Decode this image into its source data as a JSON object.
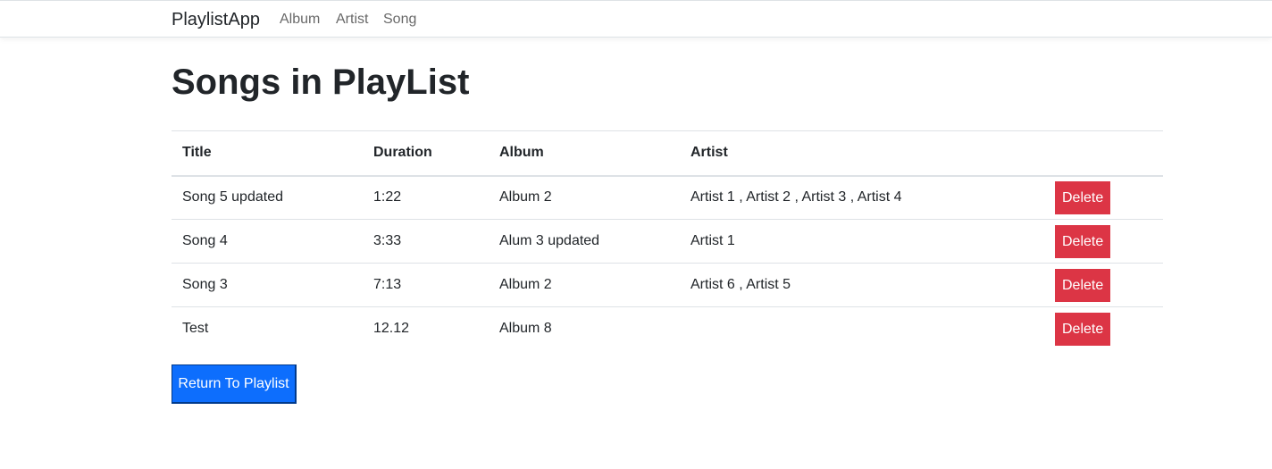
{
  "navbar": {
    "brand": "PlaylistApp",
    "links": [
      "Album",
      "Artist",
      "Song"
    ]
  },
  "page": {
    "title": "Songs in PlayList"
  },
  "table": {
    "headers": [
      "Title",
      "Duration",
      "Album",
      "Artist",
      ""
    ],
    "rows": [
      {
        "title": "Song 5 updated",
        "duration": "1:22",
        "album": "Album 2",
        "artist": "Artist 1 , Artist 2 , Artist 3 , Artist 4",
        "action": "Delete"
      },
      {
        "title": "Song 4",
        "duration": "3:33",
        "album": "Alum 3 updated",
        "artist": "Artist 1",
        "action": "Delete"
      },
      {
        "title": "Song 3",
        "duration": "7:13",
        "album": "Album 2",
        "artist": "Artist 6 , Artist 5",
        "action": "Delete"
      },
      {
        "title": "Test",
        "duration": "12.12",
        "album": "Album 8",
        "artist": "",
        "action": "Delete"
      }
    ]
  },
  "actions": {
    "return_label": "Return To Playlist"
  },
  "colors": {
    "danger": "#dc3545",
    "primary": "#0d6efd"
  }
}
